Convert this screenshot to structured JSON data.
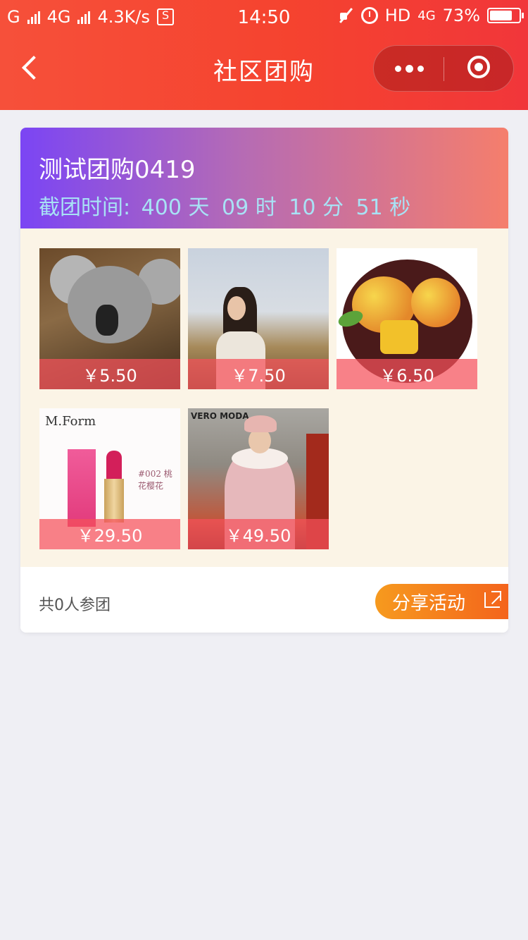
{
  "status_bar": {
    "carrier": "G",
    "network": "4G",
    "speed": "4.3K/s",
    "time": "14:50",
    "hd": "HD",
    "network_right": "4G",
    "battery": "73%"
  },
  "nav": {
    "title": "社区团购"
  },
  "group": {
    "title": "测试团购0419",
    "deadline_label": "截团时间:",
    "countdown": {
      "days": "400 天",
      "hours": "09 时",
      "minutes": "10 分",
      "seconds": "51 秒"
    }
  },
  "products": [
    {
      "price": "￥5.50",
      "image": "koala"
    },
    {
      "price": "￥7.50",
      "image": "woman-in-field"
    },
    {
      "price": "￥6.50",
      "image": "mangoes"
    },
    {
      "price": "￥29.50",
      "image": "lipstick",
      "brand": "M.Form",
      "code": "#002 桃花樱花"
    },
    {
      "price": "￥49.50",
      "image": "pink-coat",
      "brand": "VERO MODA"
    }
  ],
  "footer": {
    "participants": "共0人参团",
    "share_label": "分享活动"
  },
  "colors": {
    "nav_bg": "#f5432f",
    "card_head_start": "#7b45f4",
    "card_head_end": "#f57e6c",
    "countdown_text": "#a8e2f5",
    "body_bg": "#fbf4e6",
    "share_btn": "#f4641c"
  }
}
